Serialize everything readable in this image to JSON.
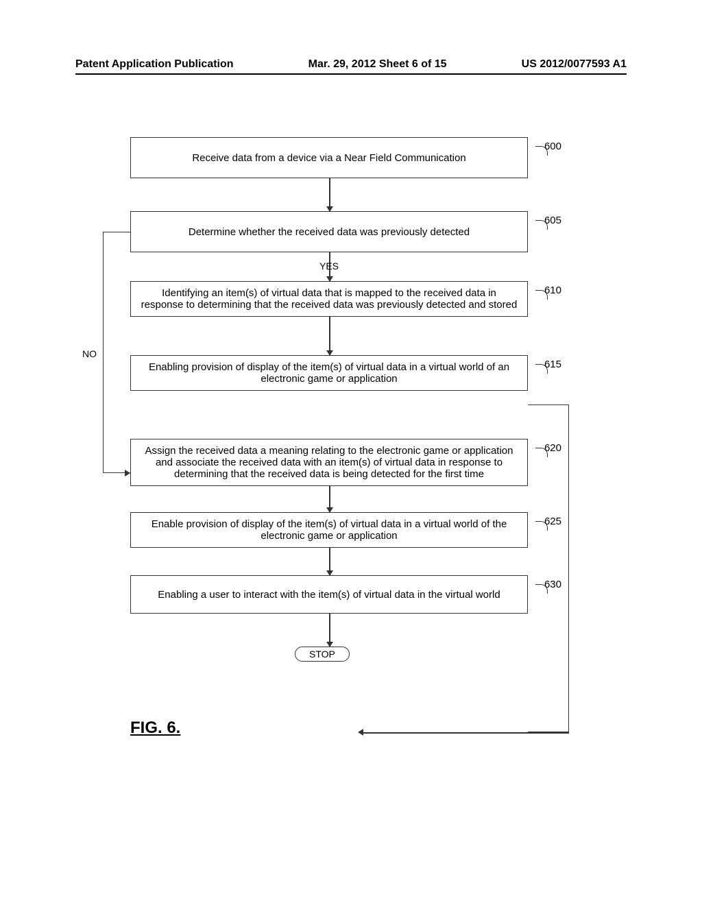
{
  "header": {
    "left": "Patent Application Publication",
    "center": "Mar. 29, 2012  Sheet 6 of 15",
    "right": "US 2012/0077593 A1"
  },
  "steps": {
    "s600": {
      "ref": "600",
      "text": "Receive data from a device via a Near Field Communication"
    },
    "s605": {
      "ref": "605",
      "text": "Determine whether the received data was previously detected"
    },
    "yes_label": "YES",
    "no_label": "NO",
    "s610": {
      "ref": "610",
      "text": "Identifying an item(s) of virtual data that is mapped to the received data in response to determining that the received data was previously detected and stored"
    },
    "s615": {
      "ref": "615",
      "text": "Enabling provision of display of the item(s) of virtual data in a virtual world of an electronic game or application"
    },
    "s620": {
      "ref": "620",
      "text": "Assign the received data a meaning relating to the electronic game or application and associate the received data with an item(s) of virtual data in response to determining that the received data is being detected for the first time"
    },
    "s625": {
      "ref": "625",
      "text": "Enable provision of display of the item(s) of virtual data in a virtual world of the electronic game or application"
    },
    "s630": {
      "ref": "630",
      "text": "Enabling a user to interact with the item(s) of virtual data in the virtual world"
    },
    "stop": "STOP"
  },
  "figure_label": "FIG. 6."
}
